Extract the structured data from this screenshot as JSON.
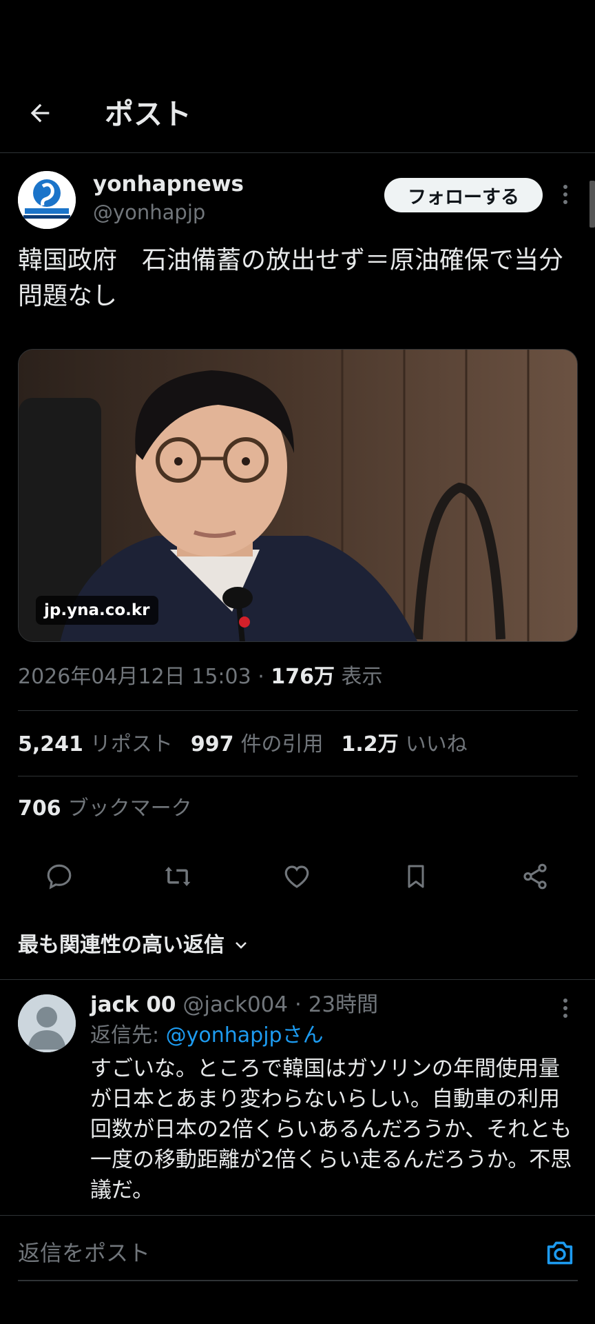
{
  "header": {
    "title": "ポスト",
    "back_icon": "arrow-left-icon"
  },
  "post": {
    "author": {
      "name": "yonhapnews",
      "handle": "@yonhapjp",
      "avatar": "yonhap-logo"
    },
    "follow_label": "フォローする",
    "text": "韓国政府　石油備蓄の放出せず＝原油確保で当分問題なし",
    "media": {
      "domain": "jp.yna.co.kr"
    },
    "meta": {
      "date": "2026年04月12日 15:03",
      "separator": "·",
      "views_count": "176万",
      "views_label": "表示"
    },
    "stats": {
      "reposts_count": "5,241",
      "reposts_label": "リポスト",
      "quotes_count": "997",
      "quotes_label": "件の引用",
      "likes_count": "1.2万",
      "likes_label": "いいね",
      "bookmarks_count": "706",
      "bookmarks_label": "ブックマーク"
    },
    "actions": [
      "reply-icon",
      "repost-icon",
      "like-icon",
      "bookmark-icon",
      "share-icon"
    ]
  },
  "replies_sort": {
    "label": "最も関連性の高い返信"
  },
  "reply": {
    "name": "jack 00",
    "handle": "@jack004",
    "time": "· 23時間",
    "reply_to_prefix": "返信先: ",
    "reply_to_mention": "@yonhapjpさん",
    "text": "すごいな。ところで韓国はガソリンの年間使用量が日本とあまり変わらないらしい。自動車の利用回数が日本の2倍くらいあるんだろうか、それとも一度の移動距離が2倍くらい走るんだろうか。不思議だ。"
  },
  "composer": {
    "placeholder": "返信をポスト"
  },
  "colors": {
    "background": "#000000",
    "text": "#e7e9ea",
    "muted": "#71767b",
    "accent": "#1d9bf0",
    "divider": "#2f3336"
  }
}
